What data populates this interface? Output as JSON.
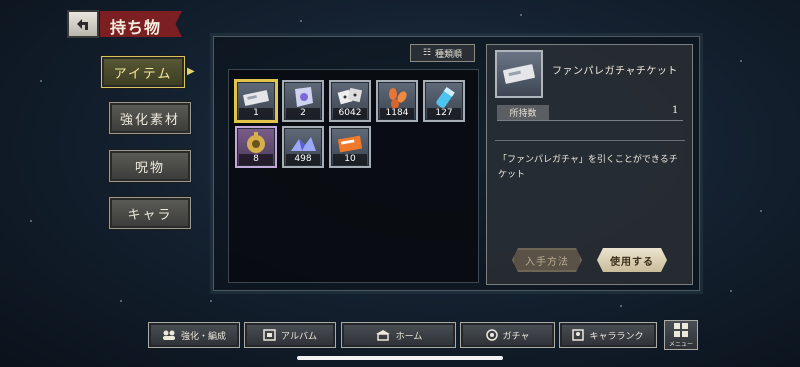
{
  "header": {
    "title": "持ち物",
    "back_icon": "back-arrow-icon"
  },
  "side_menu": {
    "items": [
      {
        "label": "アイテム",
        "active": true
      },
      {
        "label": "強化素材",
        "active": false
      },
      {
        "label": "呪物",
        "active": false
      },
      {
        "label": "キャラ",
        "active": false
      }
    ]
  },
  "sort_button": {
    "label": "種類順",
    "icon": "sort-icon"
  },
  "items": [
    {
      "icon": "ticket-icon",
      "count": "1",
      "selected": true
    },
    {
      "icon": "crystal-tag-icon",
      "count": "2"
    },
    {
      "icon": "dice-icon",
      "count": "6042"
    },
    {
      "icon": "petals-icon",
      "count": "1184"
    },
    {
      "icon": "vial-icon",
      "count": "127"
    },
    {
      "icon": "gold-gear-icon",
      "count": "8"
    },
    {
      "icon": "crystal-pile-icon",
      "count": "498"
    },
    {
      "icon": "orange-ticket-icon",
      "count": "10"
    }
  ],
  "detail": {
    "name": "ファンパレガチャチケット",
    "owned_label": "所持数",
    "owned_value": "1",
    "description": "「ファンパレガチャ」を引くことができるチケット",
    "acquire_label": "入手方法",
    "use_label": "使用する"
  },
  "bottom_nav": [
    {
      "label": "強化・編成",
      "icon": "team-icon"
    },
    {
      "label": "アルバム",
      "icon": "album-icon"
    },
    {
      "label": "ホーム",
      "icon": "home-icon"
    },
    {
      "label": "ガチャ",
      "icon": "gacha-icon"
    },
    {
      "label": "キャラランク",
      "icon": "rank-icon"
    }
  ],
  "menu_button": {
    "label": "メニュー",
    "icon": "grid-menu-icon"
  },
  "colors": {
    "accent_gold": "#e3c44a",
    "title_red": "#7b1f23",
    "bg": "#142130"
  }
}
